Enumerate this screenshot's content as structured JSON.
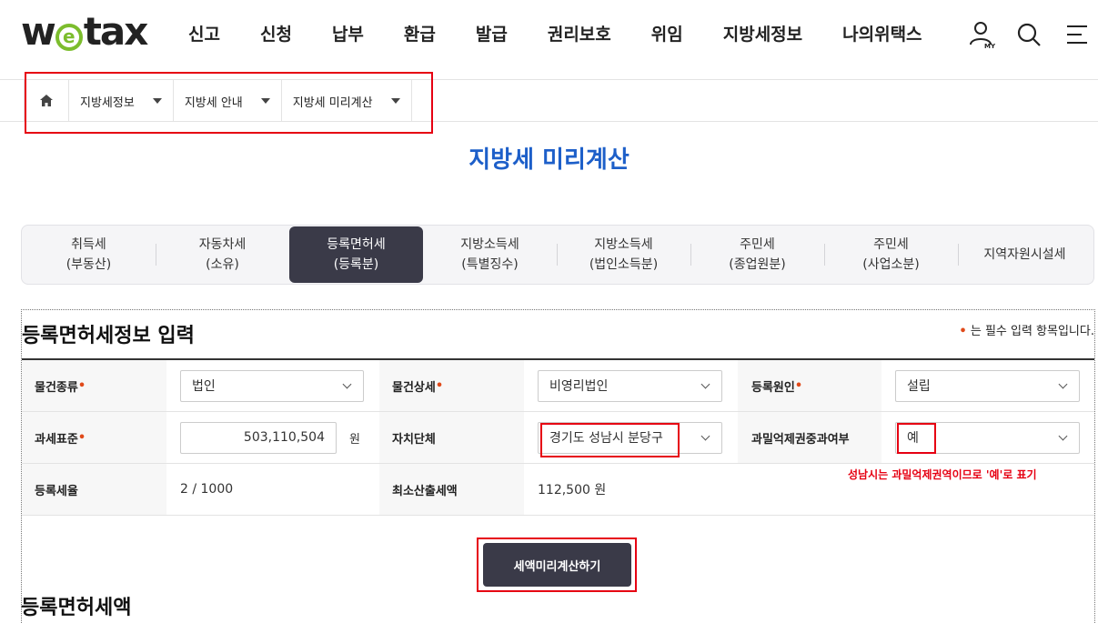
{
  "header": {
    "logo": {
      "pre": "w",
      "mid": "e",
      "post": "tax"
    },
    "nav": [
      "신고",
      "신청",
      "납부",
      "환급",
      "발급",
      "권리보호",
      "위임",
      "지방세정보",
      "나의위택스"
    ],
    "my_label": "MY"
  },
  "breadcrumb": {
    "items": [
      "지방세정보",
      "지방세 안내",
      "지방세 미리계산"
    ]
  },
  "page_title": "지방세 미리계산",
  "tabs": [
    {
      "l1": "취득세",
      "l2": "(부동산)"
    },
    {
      "l1": "자동차세",
      "l2": "(소유)"
    },
    {
      "l1": "등록면허세",
      "l2": "(등록분)"
    },
    {
      "l1": "지방소득세",
      "l2": "(특별징수)"
    },
    {
      "l1": "지방소득세",
      "l2": "(법인소득분)"
    },
    {
      "l1": "주민세",
      "l2": "(종업원분)"
    },
    {
      "l1": "주민세",
      "l2": "(사업소분)"
    },
    {
      "l1": "지역자원시설세",
      "l2": ""
    }
  ],
  "active_tab_index": 2,
  "section": {
    "title": "등록면허세정보 입력",
    "required_note": "는 필수 입력 항목입니다.",
    "required_mark": "•"
  },
  "form": {
    "property_type": {
      "label": "물건종류",
      "value": "법인"
    },
    "property_detail": {
      "label": "물건상세",
      "value": "비영리법인"
    },
    "registration_cause": {
      "label": "등록원인",
      "value": "설립"
    },
    "tax_base": {
      "label": "과세표준",
      "value": "503,110,504",
      "unit": "원"
    },
    "municipality": {
      "label": "자치단체",
      "value": "경기도 성남시 분당구"
    },
    "overcrowding": {
      "label": "과밀억제권중과여부",
      "value": "예"
    },
    "tax_rate": {
      "label": "등록세율",
      "value": "2 / 1000"
    },
    "min_tax": {
      "label": "최소산출세액",
      "value": "112,500 원"
    }
  },
  "annotation_note": "성남시는 과밀억제권역이므로 '예'로 표기",
  "calc_button": "세액미리계산하기",
  "result_title": "등록면허세액",
  "colors": {
    "accent_blue": "#1d5fc9",
    "dark_button": "#3a3a48",
    "highlight_red": "#e60012",
    "logo_green": "#7cbd2d"
  }
}
